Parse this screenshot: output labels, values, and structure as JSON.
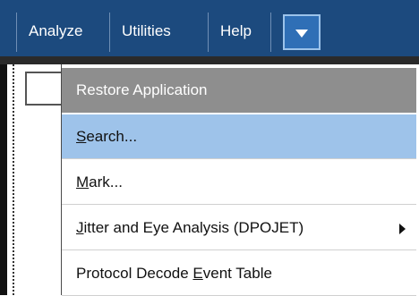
{
  "menubar": {
    "items": [
      {
        "label": "Analyze"
      },
      {
        "label": "Utilities"
      },
      {
        "label": "Help"
      }
    ],
    "dropdown_icon": "chevron-down-icon"
  },
  "dropdown": {
    "items": [
      {
        "label": "Restore Application",
        "state": "header"
      },
      {
        "label": "Search...",
        "mnemonic": "S",
        "state": "hover"
      },
      {
        "label": "Mark...",
        "mnemonic": "M"
      },
      {
        "label": "Jitter and Eye Analysis (DPOJET)",
        "mnemonic": "J",
        "has_submenu": true
      },
      {
        "label": "Protocol Decode Event Table",
        "mnemonic": "E"
      }
    ]
  },
  "colors": {
    "menubar_bg": "#1c4a7e",
    "highlight": "#9ec3ea",
    "header_bg": "#8e8e8e"
  }
}
